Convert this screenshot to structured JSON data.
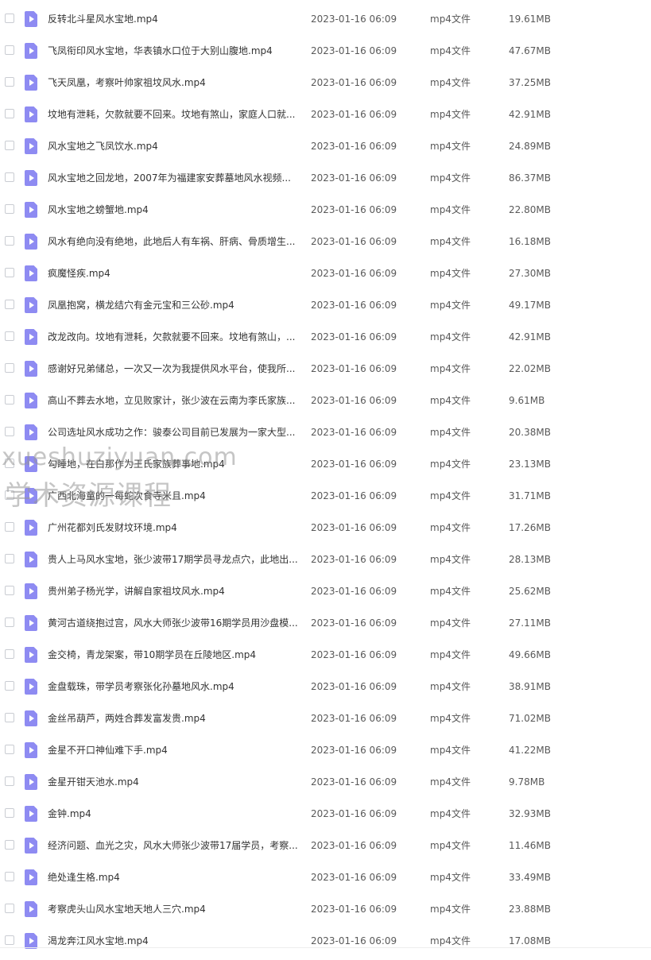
{
  "icons": {
    "checkbox": "checkbox-icon",
    "file": "video-file-icon"
  },
  "colors": {
    "file_icon": "#8e8bf2",
    "text": "#333333",
    "muted_text": "#595959"
  },
  "watermark": {
    "line1": "xueshuziyuan.com",
    "line2": "学术资源课程"
  },
  "files": [
    {
      "name": "反转北斗星风水宝地.mp4",
      "date": "2023-01-16 06:09",
      "type": "mp4文件",
      "size": "19.61MB"
    },
    {
      "name": "飞凤衔印风水宝地，华表镇水口位于大别山腹地.mp4",
      "date": "2023-01-16 06:09",
      "type": "mp4文件",
      "size": "47.67MB"
    },
    {
      "name": "飞天凤凰，考察叶帅家祖坟风水.mp4",
      "date": "2023-01-16 06:09",
      "type": "mp4文件",
      "size": "37.25MB"
    },
    {
      "name": "坟地有泄耗，欠款就要不回来。坟地有煞山，家庭人口就...",
      "date": "2023-01-16 06:09",
      "type": "mp4文件",
      "size": "42.91MB"
    },
    {
      "name": "风水宝地之飞凤饮水.mp4",
      "date": "2023-01-16 06:09",
      "type": "mp4文件",
      "size": "24.89MB"
    },
    {
      "name": "风水宝地之回龙地，2007年为福建家安葬墓地风水视频...",
      "date": "2023-01-16 06:09",
      "type": "mp4文件",
      "size": "86.37MB"
    },
    {
      "name": "风水宝地之螃蟹地.mp4",
      "date": "2023-01-16 06:09",
      "type": "mp4文件",
      "size": "22.80MB"
    },
    {
      "name": "风水有绝向没有绝地，此地后人有车祸、肝病、骨质增生...",
      "date": "2023-01-16 06:09",
      "type": "mp4文件",
      "size": "16.18MB"
    },
    {
      "name": "疯魔怪疾.mp4",
      "date": "2023-01-16 06:09",
      "type": "mp4文件",
      "size": "27.30MB"
    },
    {
      "name": "凤凰抱窝，横龙结穴有金元宝和三公砂.mp4",
      "date": "2023-01-16 06:09",
      "type": "mp4文件",
      "size": "49.17MB"
    },
    {
      "name": "改龙改向。坟地有泄耗，欠款就要不回来。坟地有煞山，...",
      "date": "2023-01-16 06:09",
      "type": "mp4文件",
      "size": "42.91MB"
    },
    {
      "name": "感谢好兄弟储总，一次又一次为我提供风水平台，使我所...",
      "date": "2023-01-16 06:09",
      "type": "mp4文件",
      "size": "22.02MB"
    },
    {
      "name": "高山不葬去水地，立见败家计，张少波在云南为李氏家族...",
      "date": "2023-01-16 06:09",
      "type": "mp4文件",
      "size": "9.61MB"
    },
    {
      "name": "公司选址风水成功之作：骏泰公司目前已发展为一家大型...",
      "date": "2023-01-16 06:09",
      "type": "mp4文件",
      "size": "20.38MB"
    },
    {
      "name": "勾睡地，在白那作为王氏家族葬事地.mp4",
      "date": "2023-01-16 06:09",
      "type": "mp4文件",
      "size": "23.13MB"
    },
    {
      "name": "广西北海童的一每蛇次食寺米且.mp4",
      "date": "2023-01-16 06:09",
      "type": "mp4文件",
      "size": "31.71MB"
    },
    {
      "name": "广州花都刘氏发财坟环境.mp4",
      "date": "2023-01-16 06:09",
      "type": "mp4文件",
      "size": "17.26MB"
    },
    {
      "name": "贵人上马风水宝地，张少波带17期学员寻龙点穴，此地出...",
      "date": "2023-01-16 06:09",
      "type": "mp4文件",
      "size": "28.13MB"
    },
    {
      "name": "贵州弟子杨光学，讲解自家祖坟风水.mp4",
      "date": "2023-01-16 06:09",
      "type": "mp4文件",
      "size": "25.62MB"
    },
    {
      "name": "黄河古道绕抱过宫，风水大师张少波带16期学员用沙盘模...",
      "date": "2023-01-16 06:09",
      "type": "mp4文件",
      "size": "27.11MB"
    },
    {
      "name": "金交椅，青龙架案，带10期学员在丘陵地区.mp4",
      "date": "2023-01-16 06:09",
      "type": "mp4文件",
      "size": "49.66MB"
    },
    {
      "name": "金盘载珠，带学员考察张化孙墓地风水.mp4",
      "date": "2023-01-16 06:09",
      "type": "mp4文件",
      "size": "38.91MB"
    },
    {
      "name": "金丝吊葫芦，两姓合葬发富发贵.mp4",
      "date": "2023-01-16 06:09",
      "type": "mp4文件",
      "size": "71.02MB"
    },
    {
      "name": "金星不开口神仙难下手.mp4",
      "date": "2023-01-16 06:09",
      "type": "mp4文件",
      "size": "41.22MB"
    },
    {
      "name": "金星开钳天池水.mp4",
      "date": "2023-01-16 06:09",
      "type": "mp4文件",
      "size": "9.78MB"
    },
    {
      "name": "金钟.mp4",
      "date": "2023-01-16 06:09",
      "type": "mp4文件",
      "size": "32.93MB"
    },
    {
      "name": "经济问题、血光之灾，风水大师张少波带17届学员，考察...",
      "date": "2023-01-16 06:09",
      "type": "mp4文件",
      "size": "11.46MB"
    },
    {
      "name": "绝处逢生格.mp4",
      "date": "2023-01-16 06:09",
      "type": "mp4文件",
      "size": "33.49MB"
    },
    {
      "name": "考察虎头山风水宝地天地人三穴.mp4",
      "date": "2023-01-16 06:09",
      "type": "mp4文件",
      "size": "23.88MB"
    },
    {
      "name": "渴龙奔江风水宝地.mp4",
      "date": "2023-01-16 06:09",
      "type": "mp4文件",
      "size": "17.08MB"
    }
  ]
}
